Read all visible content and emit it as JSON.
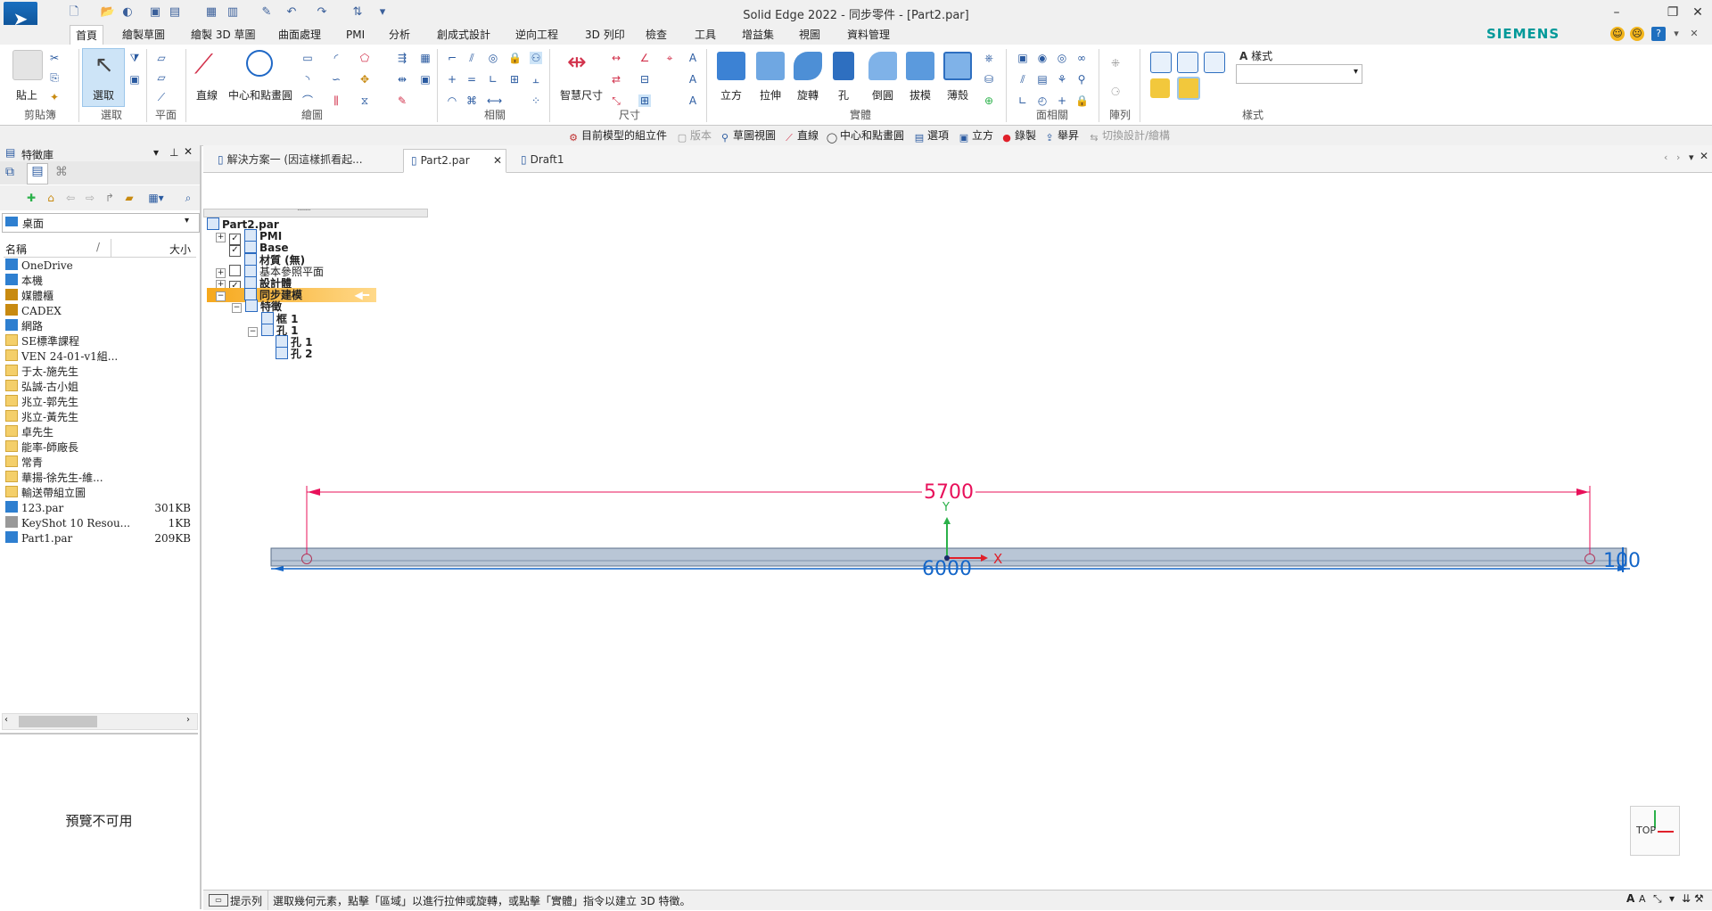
{
  "window": {
    "title": "Solid Edge 2022 - 同步零件 - [Part2.par]",
    "brand": "SIEMENS",
    "minimize": "–",
    "restore": "❐",
    "close": "✕"
  },
  "menu_tabs": [
    "首頁",
    "繪製草圖",
    "繪製 3D 草圖",
    "曲面處理",
    "PMI",
    "分析",
    "創成式設計",
    "逆向工程",
    "3D 列印",
    "檢查",
    "工具",
    "增益集",
    "視圖",
    "資料管理"
  ],
  "ribbon": {
    "groups": [
      "剪貼簿",
      "選取",
      "平面",
      "繪圖",
      "相關",
      "尺寸",
      "實體",
      "面相關",
      "陣列",
      "樣式"
    ],
    "paste": "貼上",
    "select": "選取",
    "line": "直線",
    "center_point_circle": "中心和點畫圓",
    "smart_dimension": "智慧尺寸",
    "solids": [
      "立方",
      "拉伸",
      "旋轉",
      "孔",
      "倒圓",
      "拔模",
      "薄殼"
    ],
    "style_label": "樣式"
  },
  "command_bar": [
    {
      "label": "目前模型的組立件",
      "icon": "assembly-icon"
    },
    {
      "label": "版本",
      "icon": "version-icon",
      "disabled": true
    },
    {
      "label": "草圖視圖",
      "icon": "sketch-view-icon"
    },
    {
      "label": "直線",
      "icon": "line-icon"
    },
    {
      "label": "中心和點畫圓",
      "icon": "circle-icon"
    },
    {
      "label": "選項",
      "icon": "options-icon"
    },
    {
      "label": "立方",
      "icon": "cube-icon"
    },
    {
      "label": "錄製",
      "icon": "record-icon"
    },
    {
      "label": "舉昇",
      "icon": "lift-icon"
    },
    {
      "label": "切換設計/繪構",
      "icon": "switch-icon",
      "disabled": true
    }
  ],
  "left_panel": {
    "title": "特徵庫",
    "location": "桌面",
    "col_name": "名稱",
    "col_size": "大小",
    "items": [
      {
        "name": "OneDrive",
        "size": "",
        "type": "cloud"
      },
      {
        "name": "本機",
        "size": "",
        "type": "pc"
      },
      {
        "name": "媒體櫃",
        "size": "",
        "type": "lib"
      },
      {
        "name": "CADEX",
        "size": "",
        "type": "user"
      },
      {
        "name": "網路",
        "size": "",
        "type": "net"
      },
      {
        "name": "SE標準課程",
        "size": "",
        "type": "folder"
      },
      {
        "name": "VEN 24-01-v1組...",
        "size": "",
        "type": "folder"
      },
      {
        "name": "于太-施先生",
        "size": "",
        "type": "folder"
      },
      {
        "name": "弘誠-古小姐",
        "size": "",
        "type": "folder"
      },
      {
        "name": "兆立-郭先生",
        "size": "",
        "type": "folder"
      },
      {
        "name": "兆立-黃先生",
        "size": "",
        "type": "folder"
      },
      {
        "name": "卓先生",
        "size": "",
        "type": "folder"
      },
      {
        "name": "能率-師廠長",
        "size": "",
        "type": "folder"
      },
      {
        "name": "常青",
        "size": "",
        "type": "folder"
      },
      {
        "name": "華揚-徐先生-維...",
        "size": "",
        "type": "folder"
      },
      {
        "name": "輸送帶組立圖",
        "size": "",
        "type": "folder"
      },
      {
        "name": "123.par",
        "size": "301KB",
        "type": "par"
      },
      {
        "name": "KeyShot 10 Resou...",
        "size": "1KB",
        "type": "link"
      },
      {
        "name": "Part1.par",
        "size": "209KB",
        "type": "par"
      }
    ],
    "preview_text": "預覽不可用"
  },
  "doc_tabs": [
    {
      "label": "解決方案一 (因這樣抓看起...",
      "active": false,
      "closable": false
    },
    {
      "label": "Part2.par",
      "active": true,
      "closable": true
    },
    {
      "label": "Draft1",
      "active": false,
      "closable": false
    }
  ],
  "tree": [
    {
      "label": "Part2.par",
      "level": 0,
      "expand": "",
      "check": "",
      "bold": true
    },
    {
      "label": "PMI",
      "level": 1,
      "expand": "+",
      "check": "✓",
      "bold": true
    },
    {
      "label": "Base",
      "level": 1,
      "expand": "",
      "check": "✓",
      "bold": true
    },
    {
      "label": "材質 (無)",
      "level": 1,
      "expand": "",
      "check": "",
      "bold": true
    },
    {
      "label": "基本參照平面",
      "level": 1,
      "expand": "+",
      "check": " ",
      "bold": false
    },
    {
      "label": "設計體",
      "level": 1,
      "expand": "+",
      "check": "✓",
      "bold": true
    },
    {
      "label": "同步建模",
      "level": 1,
      "expand": "−",
      "check": "",
      "bold": true
    },
    {
      "label": "特徵",
      "level": 2,
      "expand": "−",
      "check": "",
      "bold": true
    },
    {
      "label": "框 1",
      "level": 3,
      "expand": "",
      "check": "",
      "bold": true
    },
    {
      "label": "孔 1",
      "level": 3,
      "expand": "−",
      "check": "",
      "bold": true
    },
    {
      "label": "孔 1",
      "level": 4,
      "expand": "",
      "check": "",
      "bold": true
    },
    {
      "label": "孔 2",
      "level": 4,
      "expand": "",
      "check": "",
      "bold": true
    }
  ],
  "canvas": {
    "dim_top": "5700",
    "dim_bottom": "6000",
    "dim_right": "100",
    "axis_y": "Y",
    "axis_x": "X",
    "view_cube": "TOP",
    "colors": {
      "dimension": "#e8105a",
      "dim_blue": "#1466c8",
      "bar": "#b9c6d6",
      "axis_y": "#2bb14a",
      "axis_x": "#e0202a"
    }
  },
  "status": {
    "label": "提示列",
    "message": "選取幾何元素，點擊「區域」以進行拉伸或旋轉，或點擊「實體」指令以建立 3D 特徵。"
  }
}
